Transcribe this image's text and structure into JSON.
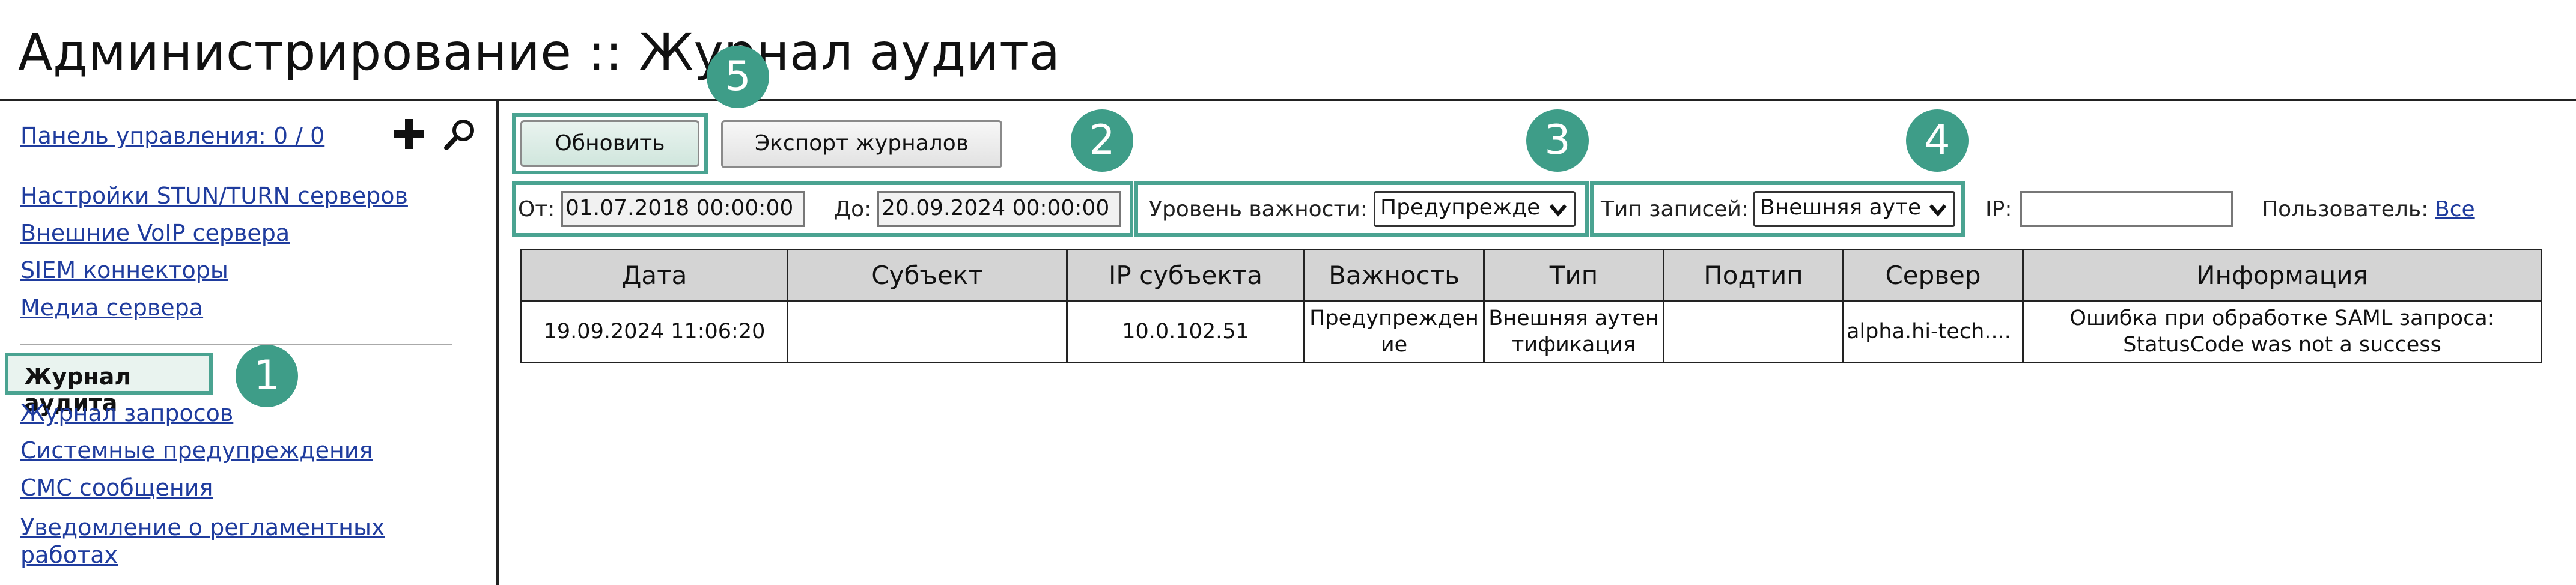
{
  "page": {
    "title": "Администрирование :: Журнал аудита"
  },
  "sidebar": {
    "dashboard_link": "Панель управления: 0 / 0",
    "items": [
      {
        "label": "Настройки STUN/TURN серверов"
      },
      {
        "label": "Внешние VoIP сервера"
      },
      {
        "label": "SIEM коннекторы"
      },
      {
        "label": "Медиа сервера"
      }
    ],
    "active_item": "Журнал аудита",
    "items2": [
      {
        "label": "Журнал запросов"
      },
      {
        "label": "Системные предупреждения"
      },
      {
        "label": "СМС сообщения"
      },
      {
        "label": "Уведомление о регламентных"
      },
      {
        "label": "работах"
      }
    ],
    "icons": {
      "add": "plus-icon",
      "search": "search-icon"
    }
  },
  "badges": [
    "1",
    "2",
    "3",
    "4",
    "5"
  ],
  "toolbar": {
    "refresh_label": "Обновить",
    "export_label": "Экспорт журналов",
    "from_label": "От:",
    "from_value": "01.07.2018 00:00:00",
    "to_label": "До:",
    "to_value": "20.09.2024 00:00:00",
    "severity_label": "Уровень важности:",
    "severity_value": "Предупрежде",
    "type_label": "Тип записей:",
    "type_value": "Внешняя ауте",
    "ip_label": "IP:",
    "ip_value": "",
    "user_label": "Пользователь:",
    "user_link": "Все"
  },
  "table": {
    "columns": [
      "Дата",
      "Субъект",
      "IP субъекта",
      "Важность",
      "Тип",
      "Подтип",
      "Сервер",
      "Информация"
    ],
    "rows": [
      {
        "date": "19.09.2024 11:06:20",
        "subject": "",
        "ip": "10.0.102.51",
        "severity_1": "Предупрежден",
        "severity_2": "ие",
        "type_1": "Внешняя аутен",
        "type_2": "тификация",
        "subtype": "",
        "server": "alpha.hi-tech....",
        "info_1": "Ошибка при обработке SAML запроса:",
        "info_2": "StatusCode was not a success"
      }
    ]
  },
  "colors": {
    "accent": "#3e9d88",
    "highlight_border": "#4aa391",
    "link": "#1f3c9e",
    "header_bg": "#d4d4d4"
  }
}
